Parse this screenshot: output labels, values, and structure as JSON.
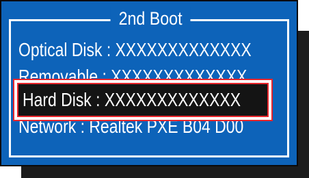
{
  "dialog": {
    "title": "2nd Boot",
    "options": [
      {
        "label": "Optical Disk : XXXXXXXXXXXXX"
      },
      {
        "label": "Removable : XXXXXXXXXXXXX"
      },
      {
        "label": "Hard Disk : XXXXXXXXXXXXX",
        "selected": true
      },
      {
        "label": "Network : Realtek PXE B04 D00"
      }
    ]
  },
  "colors": {
    "background": "#0d63b9",
    "text": "#ffffff",
    "selection_fill": "#141414",
    "selection_border": "#e8252b",
    "shadow": "#1c1c1c"
  }
}
